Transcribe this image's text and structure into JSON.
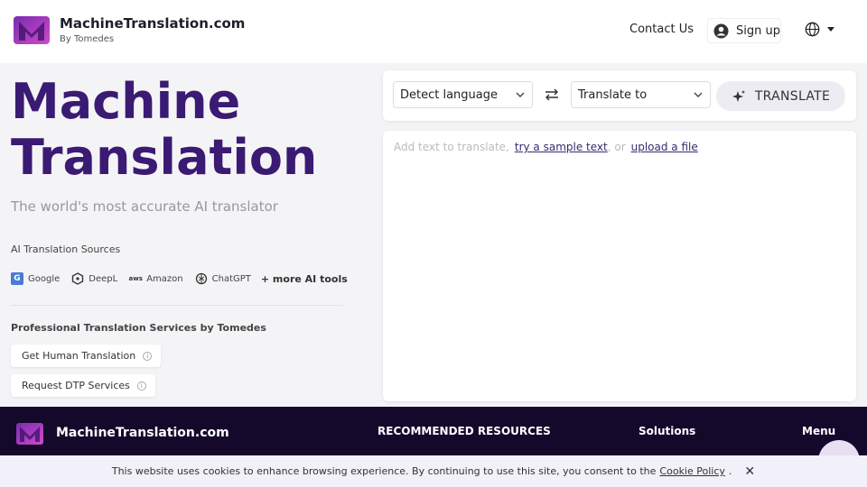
{
  "header": {
    "brand_name": "MachineTranslation.com",
    "brand_sub": "By Tomedes",
    "contact": "Contact Us",
    "signup": "Sign up"
  },
  "hero": {
    "title_line1": "Machine",
    "title_line2": "Translation",
    "subtitle": "The world's most accurate AI translator",
    "sources_label": "AI Translation Sources",
    "sources": [
      "Google",
      "DeepL",
      "Amazon",
      "ChatGPT"
    ],
    "more_tools": "+ more AI tools",
    "pro_title": "Professional Translation Services by Tomedes",
    "pro_buttons": [
      "Get Human Translation",
      "Request DTP Services"
    ]
  },
  "translator": {
    "source_lang": "Detect language",
    "target_lang": "Translate to",
    "translate_button": "TRANSLATE",
    "placeholder_prefix": "Add text to translate,",
    "sample_link": "try a sample text",
    "or_text": ", or",
    "upload_link": "upload a file"
  },
  "footer": {
    "brand": "MachineTranslation.com",
    "resources": "RECOMMENDED RESOURCES",
    "solutions": "Solutions",
    "menu": "Menu"
  },
  "cookie": {
    "text": "This website uses cookies to enhance browsing experience. By continuing to use this site, you consent to the",
    "link": "Cookie Policy",
    "end": ".",
    "close": "✕"
  },
  "colors": {
    "accent": "#3b1a73",
    "footer_bg": "#14082b",
    "logo_left": "#6b2aa8",
    "logo_right": "#c23cc0"
  },
  "icons": [
    "logo-icon",
    "user-icon",
    "globe-icon",
    "chevron-down-icon",
    "google-icon",
    "deepl-icon",
    "amazon-icon",
    "chatgpt-icon",
    "info-icon",
    "swap-icon",
    "sparkle-icon",
    "close-icon"
  ]
}
